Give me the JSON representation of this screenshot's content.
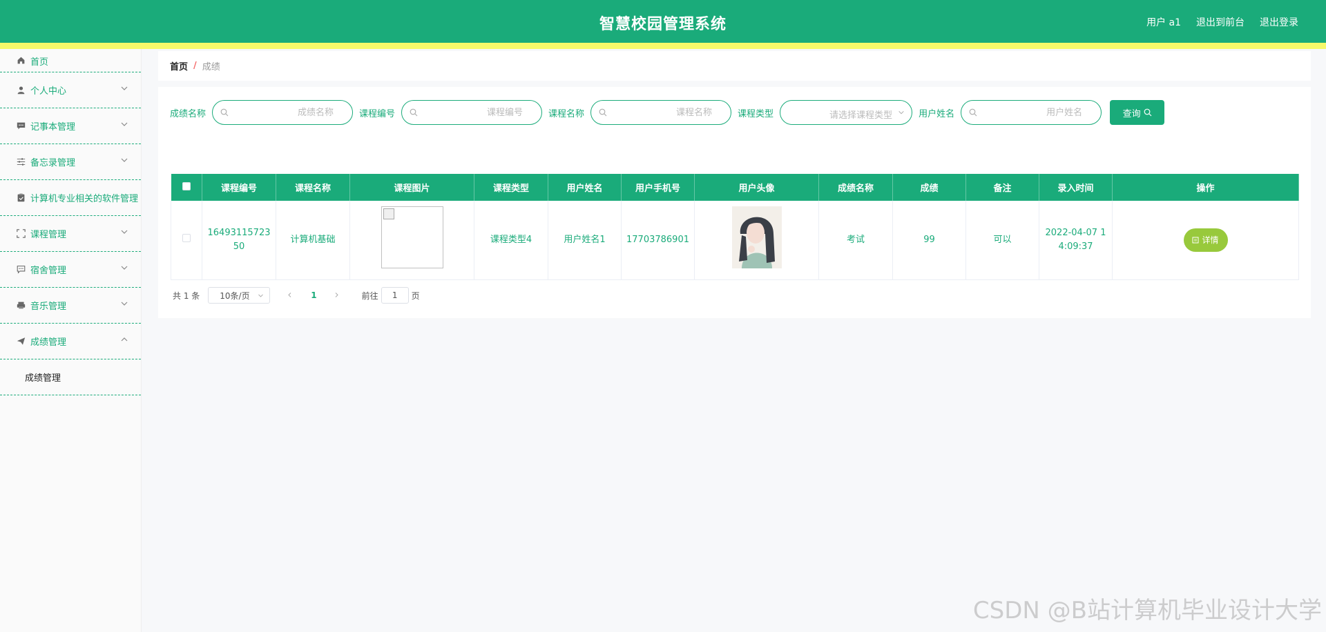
{
  "header": {
    "title": "智慧校园管理系统",
    "user_label": "用户 a1",
    "to_front_label": "退出到前台",
    "logout_label": "退出登录"
  },
  "sidebar": {
    "items": [
      {
        "label": "首页",
        "icon": "home-icon"
      },
      {
        "label": "个人中心",
        "icon": "user-icon"
      },
      {
        "label": "记事本管理",
        "icon": "message-icon"
      },
      {
        "label": "备忘录管理",
        "icon": "sliders-icon"
      },
      {
        "label": "计算机专业相关的软件管理",
        "icon": "clipboard-icon"
      },
      {
        "label": "课程管理",
        "icon": "fullscreen-icon"
      },
      {
        "label": "宿舍管理",
        "icon": "chat-icon"
      },
      {
        "label": "音乐管理",
        "icon": "printer-icon"
      },
      {
        "label": "成绩管理",
        "icon": "send-icon"
      }
    ],
    "submenu": {
      "label": "成绩管理"
    }
  },
  "breadcrumb": {
    "home": "首页",
    "separator": "/",
    "current": "成绩"
  },
  "filters": {
    "score_name": {
      "label": "成绩名称",
      "placeholder": "成绩名称"
    },
    "course_no": {
      "label": "课程编号",
      "placeholder": "课程编号"
    },
    "course_name": {
      "label": "课程名称",
      "placeholder": "课程名称"
    },
    "course_type": {
      "label": "课程类型",
      "placeholder": "请选择课程类型"
    },
    "user_name": {
      "label": "用户姓名",
      "placeholder": "用户姓名"
    },
    "search_label": "查询"
  },
  "table": {
    "headers": [
      "课程编号",
      "课程名称",
      "课程图片",
      "课程类型",
      "用户姓名",
      "用户手机号",
      "用户头像",
      "成绩名称",
      "成绩",
      "备注",
      "录入时间",
      "操作"
    ],
    "rows": [
      {
        "course_no": "1649311572350",
        "course_name": "计算机基础",
        "course_type": "课程类型4",
        "user_name": "用户姓名1",
        "phone": "17703786901",
        "score_name": "考试",
        "score": "99",
        "remark": "可以",
        "time": "2022-04-07 14:09:37",
        "action_label": "详情"
      }
    ]
  },
  "pager": {
    "total": "共 1 条",
    "page_size": "10条/页",
    "current_page": "1",
    "goto_prefix": "前往",
    "goto_value": "1",
    "goto_suffix": "页"
  },
  "watermark": "CSDN @B站计算机毕业设计大学",
  "colors": {
    "primary": "#1aab7a",
    "strip": "#f6f96a",
    "detail": "#98c93c"
  }
}
